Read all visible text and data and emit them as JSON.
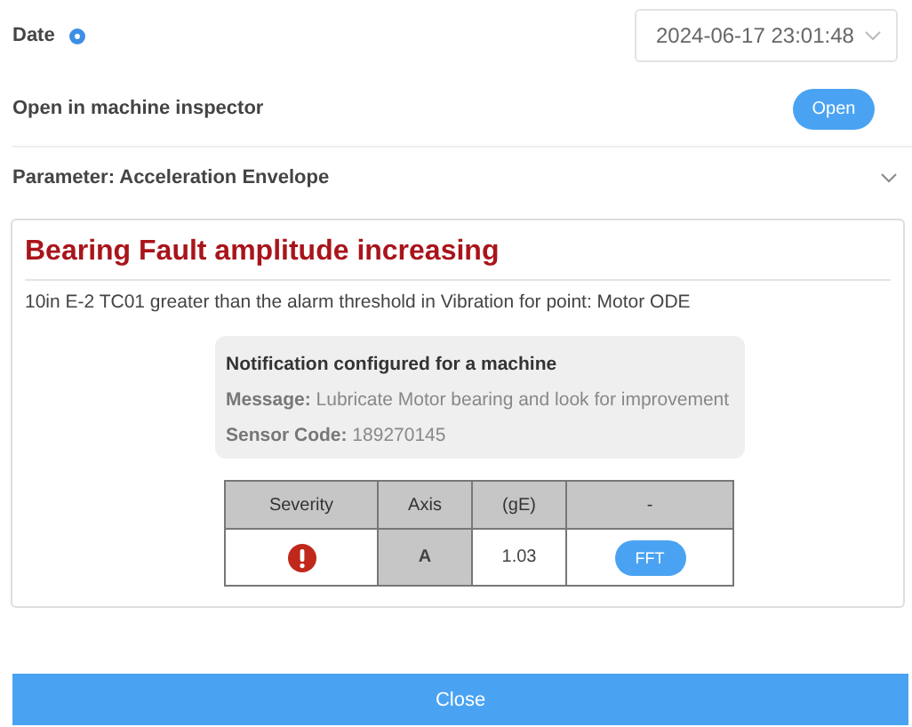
{
  "date": {
    "label": "Date",
    "value": "2024-06-17 23:01:48"
  },
  "inspector": {
    "label": "Open in machine inspector",
    "button": "Open"
  },
  "parameter": {
    "label": "Parameter: Acceleration Envelope"
  },
  "alert": {
    "title": "Bearing Fault amplitude increasing",
    "description": "10in E-2 TC01 greater than the alarm threshold in Vibration for point: Motor ODE",
    "notification": {
      "title": "Notification configured for a machine",
      "lines": [
        "**Message:** Lubricate Motor bearing and look for improvement",
        "**Sensor Code:** 189270145"
      ]
    },
    "table": {
      "columns": [
        "Severity",
        "Axis",
        "(gE)",
        "-"
      ],
      "rows": [
        {
          "color": "#c0281b",
          "axis": "A",
          "value": "1.03",
          "action": "FFT"
        }
      ]
    }
  },
  "footer": {
    "button": "Close"
  }
}
